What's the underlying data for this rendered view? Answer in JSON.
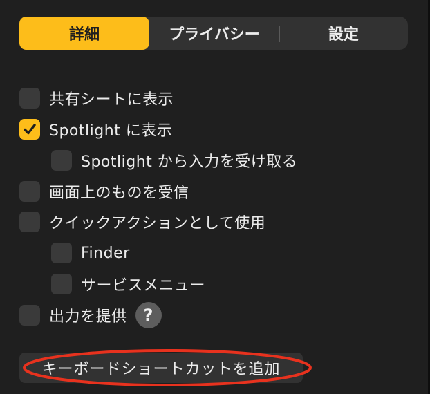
{
  "tabs": [
    {
      "label": "詳細",
      "active": true
    },
    {
      "label": "プライバシー",
      "active": false
    },
    {
      "label": "設定",
      "active": false
    }
  ],
  "options": {
    "share_sheet": {
      "label": "共有シートに表示",
      "checked": false
    },
    "spotlight": {
      "label": "Spotlight に表示",
      "checked": true
    },
    "spotlight_input": {
      "label": "Spotlight から入力を受け取る",
      "checked": false
    },
    "onscreen": {
      "label": "画面上のものを受信",
      "checked": false
    },
    "quick_action": {
      "label": "クイックアクションとして使用",
      "checked": false
    },
    "finder": {
      "label": "Finder",
      "checked": false
    },
    "services": {
      "label": "サービスメニュー",
      "checked": false
    },
    "output": {
      "label": "出力を提供",
      "checked": false
    }
  },
  "help": {
    "label": "?"
  },
  "shortcut_button": {
    "label": "キーボードショートカットを追加"
  },
  "colors": {
    "accent": "#fdbd1a",
    "annotation": "#e8321e",
    "background": "#1f1f1f"
  }
}
